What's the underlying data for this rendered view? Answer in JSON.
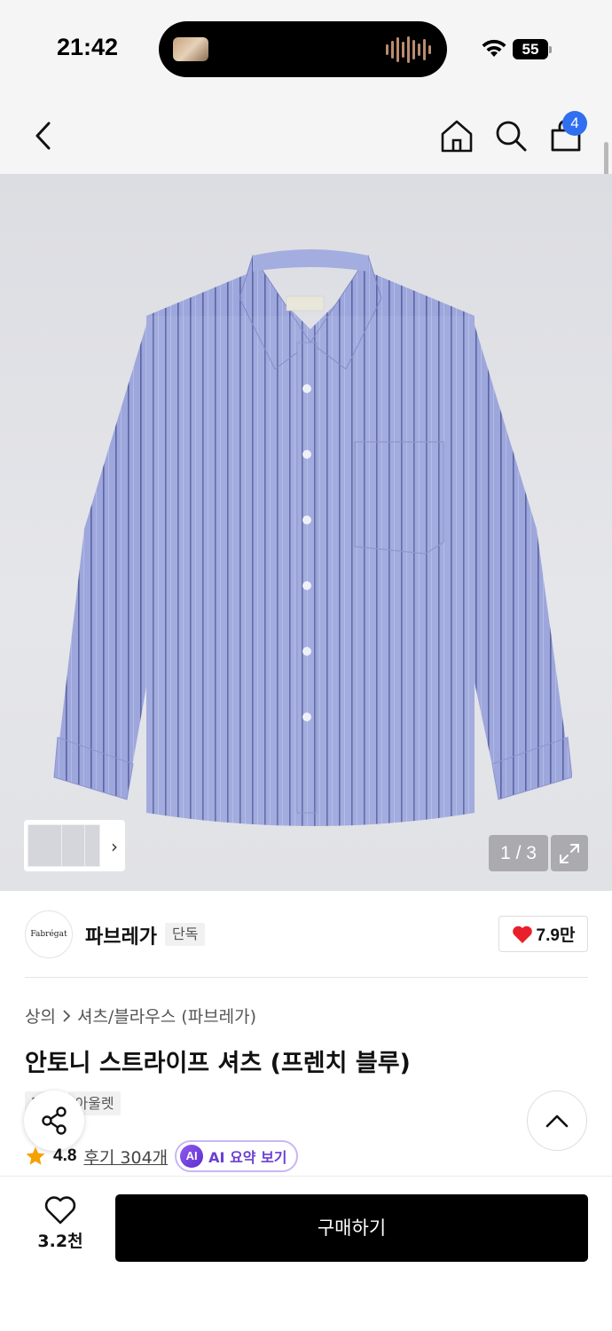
{
  "status_bar": {
    "time": "21:42",
    "battery": "55"
  },
  "nav": {
    "cart_count": "4",
    "icons": [
      "chevron-left-icon",
      "home-icon",
      "search-icon",
      "shopping-bag-icon"
    ]
  },
  "gallery": {
    "pager": "1 / 3",
    "thumbnail_count": 3
  },
  "brand": {
    "logo_text": "Fabrégat",
    "name": "파브레가",
    "badge": "단독",
    "likes": "7.9만"
  },
  "product": {
    "breadcrumb": [
      "상의",
      "셔츠/블라우스 (파브레가)"
    ],
    "title": "안토니 스트라이프 셔츠 (프렌치 블루)",
    "tags": [
      "단독",
      "아울렛"
    ],
    "rating": "4.8",
    "reviews": "후기 304개",
    "ai_chip": "AI 요약 보기",
    "ai_icon_text": "AI"
  },
  "bottom_bar": {
    "wish_count": "3.2천",
    "buy_label": "구매하기"
  },
  "colors": {
    "accent": "#2f6ff0",
    "heart": "#e8202b",
    "star": "#f5a100",
    "ai": "#6a3fd3"
  }
}
